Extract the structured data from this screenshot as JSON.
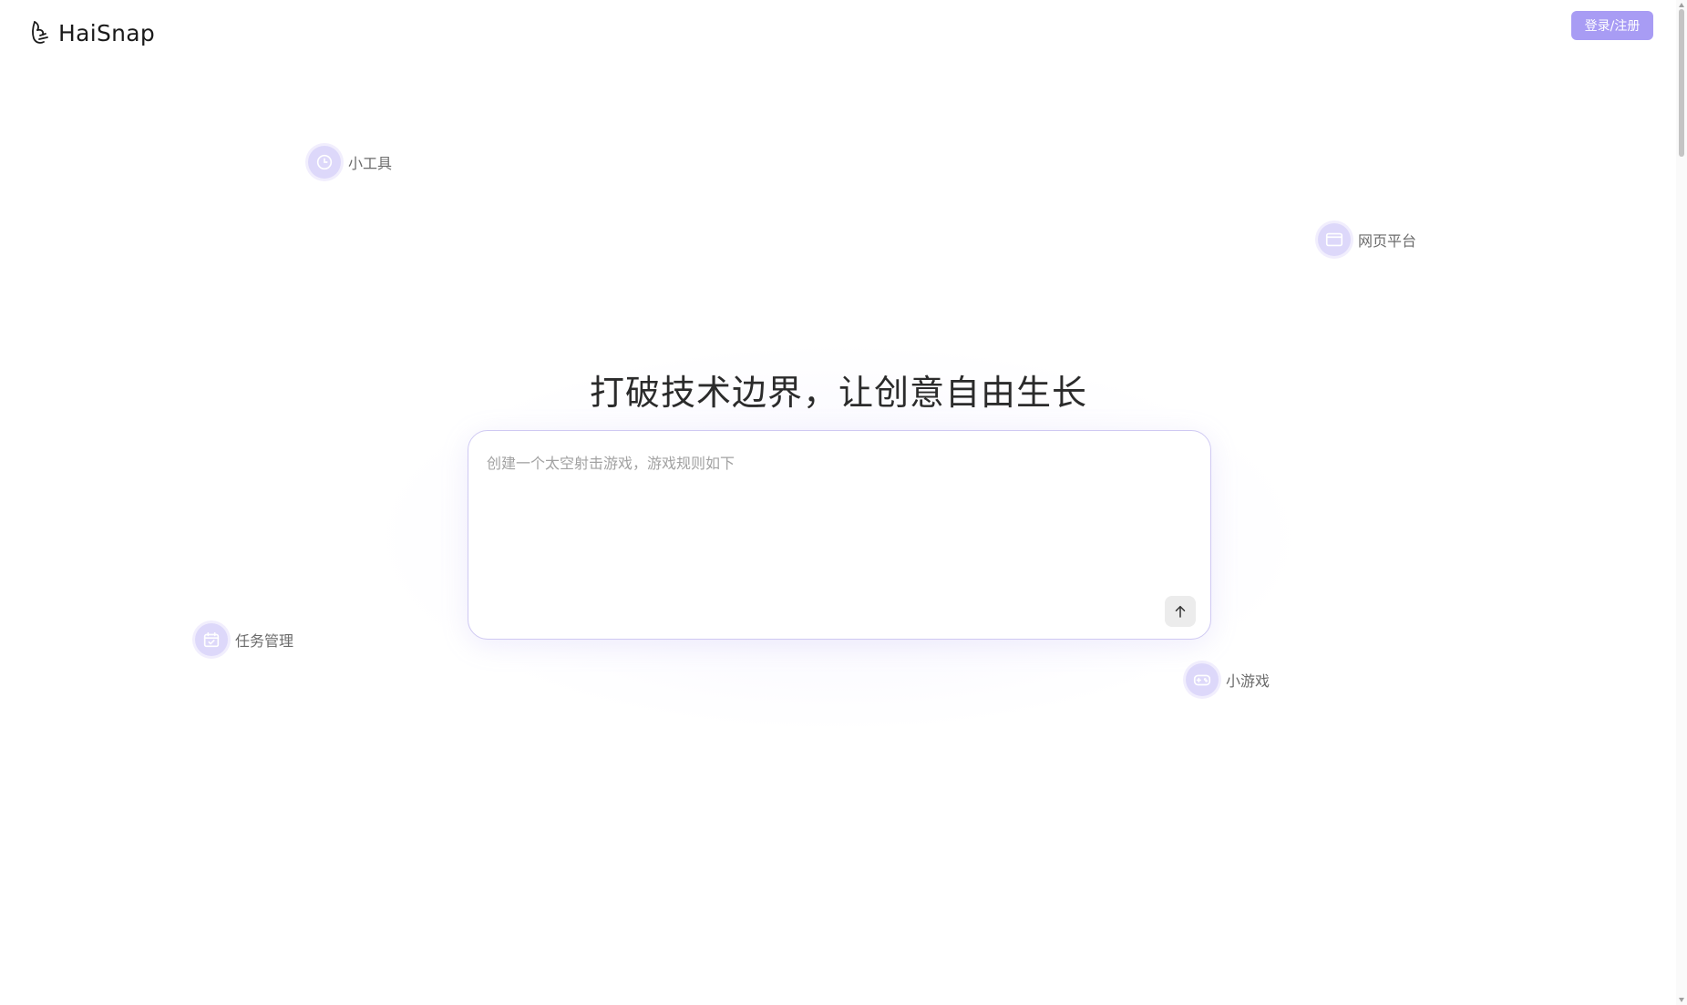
{
  "brand": {
    "name": "HaiSnap"
  },
  "header": {
    "login_label": "登录/注册"
  },
  "hero": {
    "headline": "打破技术边界，让创意自由生长",
    "prompt_placeholder": "创建一个太空射击游戏，游戏规则如下"
  },
  "tags": {
    "tools": {
      "label": "小工具",
      "icon": "clock-icon"
    },
    "web": {
      "label": "网页平台",
      "icon": "browser-window-icon"
    },
    "tasks": {
      "label": "任务管理",
      "icon": "calendar-check-icon"
    },
    "games": {
      "label": "小游戏",
      "icon": "gamepad-icon"
    }
  },
  "colors": {
    "accent": "#a89cf4",
    "tag_bg": "#ddd8fa",
    "border": "#cfc9f2"
  }
}
